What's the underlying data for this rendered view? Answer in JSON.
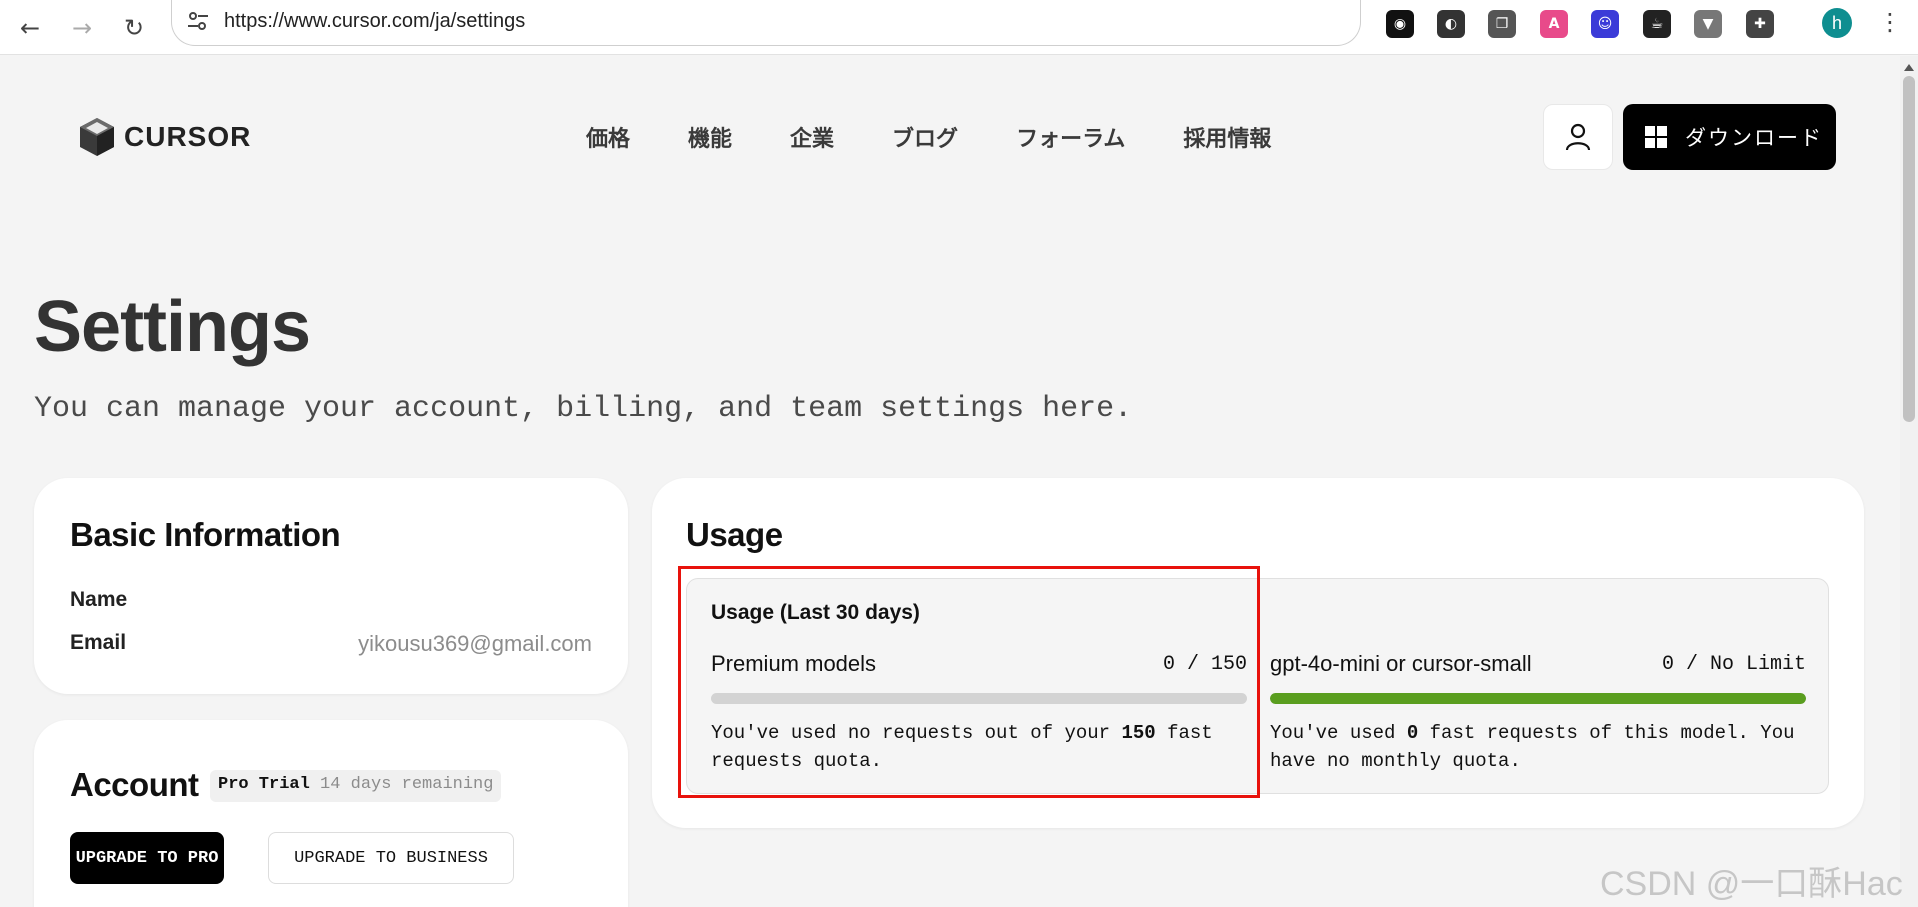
{
  "browser": {
    "url": "https://www.cursor.com/ja/settings",
    "profile_initial": "h",
    "extensions": [
      {
        "icon": "mask-extension-icon",
        "color": "#111111",
        "glyph": "◉"
      },
      {
        "icon": "spy-extension-icon",
        "color": "#333333",
        "glyph": "◐"
      },
      {
        "icon": "copy-extension-icon",
        "color": "#555555",
        "glyph": "❐"
      },
      {
        "icon": "translate-extension-icon",
        "color": "#e84a8a",
        "glyph": "A"
      },
      {
        "icon": "face-extension-icon",
        "color": "#3b3bd8",
        "glyph": "☺"
      },
      {
        "icon": "cup-extension-icon",
        "color": "#222222",
        "glyph": "☕"
      },
      {
        "icon": "vue-extension-icon",
        "color": "#777777",
        "glyph": "▼"
      },
      {
        "icon": "puzzle-extension-icon",
        "color": "#444444",
        "glyph": "✚"
      }
    ]
  },
  "site": {
    "logo_text": "CURSOR",
    "nav": [
      "価格",
      "機能",
      "企業",
      "ブログ",
      "フォーラム",
      "採用情報"
    ],
    "download_label": "ダウンロード"
  },
  "page": {
    "title": "Settings",
    "subtitle": "You can manage your account, billing, and team settings here."
  },
  "basic_info": {
    "title": "Basic Information",
    "name_label": "Name",
    "name_value": "",
    "email_label": "Email",
    "email_value": "yikousu369@gmail.com"
  },
  "account": {
    "title": "Account",
    "plan": "Pro Trial",
    "remaining": "14 days remaining",
    "upgrade_pro": "UPGRADE TO PRO",
    "upgrade_business": "UPGRADE TO BUSINESS"
  },
  "usage": {
    "title": "Usage",
    "header": "Usage (Last 30 days)",
    "models": [
      {
        "name": "Premium models",
        "count": "0 / 150",
        "used_fraction": 0.0,
        "bar_color": "#d3d3d3",
        "desc_pre": "You've used no requests out of your ",
        "desc_bold": "150",
        "desc_post": " fast requests quota."
      },
      {
        "name": "gpt-4o-mini or cursor-small",
        "count": "0 / No Limit",
        "used_fraction": 1.0,
        "bar_color": "#5a9e1f",
        "desc_pre": "You've used ",
        "desc_bold": "0",
        "desc_post": " fast requests of this model. You have no monthly quota."
      }
    ]
  },
  "watermark": "CSDN @一口酥Hac",
  "colors": {
    "highlight": "#e8120c",
    "accent_green": "#5a9e1f"
  }
}
